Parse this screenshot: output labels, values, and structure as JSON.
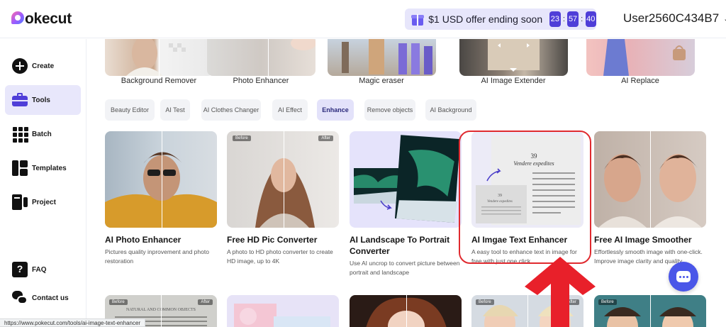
{
  "brand": {
    "name": "okecut"
  },
  "offer": {
    "text": "$1 USD offer ending soon",
    "hours": "23",
    "minutes": "57",
    "seconds": "40"
  },
  "user": {
    "name": "User2560C434B7"
  },
  "sidebar": {
    "items": [
      {
        "label": "Create",
        "icon": "plus-circle-icon"
      },
      {
        "label": "Tools",
        "icon": "toolbox-icon",
        "active": true
      },
      {
        "label": "Batch",
        "icon": "grid-icon"
      },
      {
        "label": "Templates",
        "icon": "templates-icon"
      },
      {
        "label": "Project",
        "icon": "project-icon"
      },
      {
        "label": "FAQ",
        "icon": "faq-icon"
      },
      {
        "label": "Contact us",
        "icon": "chat-icon"
      }
    ]
  },
  "categories": [
    "Background Remover",
    "Photo Enhancer",
    "Magic eraser",
    "AI Image Extender",
    "AI Replace"
  ],
  "chips": [
    {
      "label": "Beauty Editor"
    },
    {
      "label": "AI Test"
    },
    {
      "label": "AI Clothes Changer"
    },
    {
      "label": "AI Effect"
    },
    {
      "label": "Enhance",
      "active": true
    },
    {
      "label": "Remove objects"
    },
    {
      "label": "AI Background"
    }
  ],
  "tools": [
    {
      "title": "AI Photo Enhancer",
      "desc": "Pictures quality inprovement and photo restoration"
    },
    {
      "title": "Free HD Pic Converter",
      "desc": "A photo to HD photo converter to create HD image, up to 4K",
      "before": "Before",
      "after": "After"
    },
    {
      "title": "AI Landscape To Portrait Converter",
      "desc": "Use AI uncrop to convert picture between portrait and landscape"
    },
    {
      "title": "AI Imgae Text Enhancer",
      "desc": "A easy tool to enhance text in image for free with just one click",
      "page_number": "39",
      "page_heading": "Vendere expedites"
    },
    {
      "title": "Free AI Image Smoother",
      "desc": "Effortlessly smooth image with one-click. Improve image clarity and quality"
    }
  ],
  "row3": {
    "before": "Before",
    "after": "After",
    "doc_text": "NATURAL AND COMMON OBJECTS"
  },
  "status_url": "https://www.pokecut.com/tools/ai-image-text-enhancer",
  "colors": {
    "accent": "#4f3ed8",
    "highlight": "#e02a2f",
    "arrow": "#e8202a"
  }
}
